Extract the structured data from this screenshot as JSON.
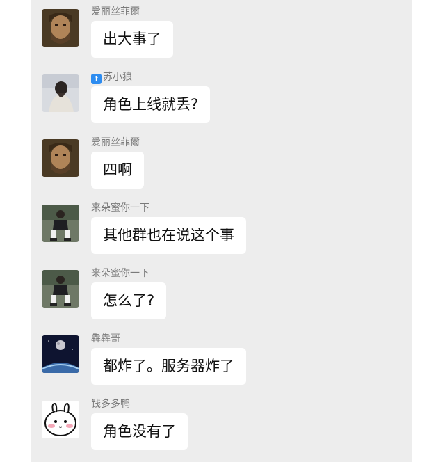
{
  "messages": [
    {
      "sender": "爱丽丝菲爾",
      "text": "出大事了",
      "avatar": "bearded-man-avatar"
    },
    {
      "sender": "苏小狼",
      "text": "角色上线就丢?",
      "avatar": "person-photo-avatar",
      "badge": "↑"
    },
    {
      "sender": "爱丽丝菲爾",
      "text": "四啊",
      "avatar": "bearded-man-avatar"
    },
    {
      "sender": "来朵蜜你一下",
      "text": "其他群也在说这个事",
      "avatar": "sitting-figure-avatar"
    },
    {
      "sender": "来朵蜜你一下",
      "text": "怎么了?",
      "avatar": "sitting-figure-avatar"
    },
    {
      "sender": "犇犇哥",
      "text": "都炸了。服务器炸了",
      "avatar": "planet-moon-avatar"
    },
    {
      "sender": "钱多多鸭",
      "text": "角色没有了",
      "avatar": "cartoon-face-avatar"
    }
  ],
  "colors": {
    "chat_background": "#ededed",
    "bubble": "#ffffff",
    "sender_name": "#7a7a7a",
    "message_text": "#111111",
    "badge": "#2d8cf0"
  }
}
